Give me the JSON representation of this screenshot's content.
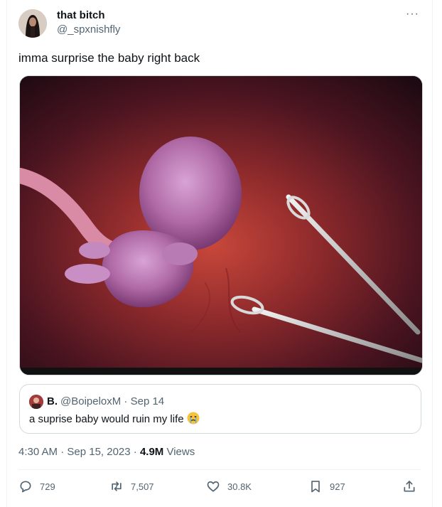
{
  "author": {
    "name": "that bitch",
    "handle": "@_spxnishfly"
  },
  "more_label": "···",
  "tweet": {
    "text": "imma surprise the baby right back"
  },
  "quote": {
    "name": "B.",
    "handle_time": "@BoipeloxM · Sep 14",
    "text": "a suprise baby would ruin my life",
    "emoji": "crying-face"
  },
  "meta": {
    "time_date": "4:30 AM · Sep 15, 2023 · ",
    "views_count": "4.9M",
    "views_label": " Views"
  },
  "actions": {
    "replies": "729",
    "retweets": "7,507",
    "likes": "30.8K",
    "bookmarks": "927"
  },
  "colors": {
    "text": "#0f1419",
    "secondary": "#536471",
    "border": "#cfd9de",
    "media_bg": "#5a1620"
  },
  "icons": [
    "reply-icon",
    "retweet-icon",
    "like-icon",
    "bookmark-icon",
    "share-icon"
  ]
}
